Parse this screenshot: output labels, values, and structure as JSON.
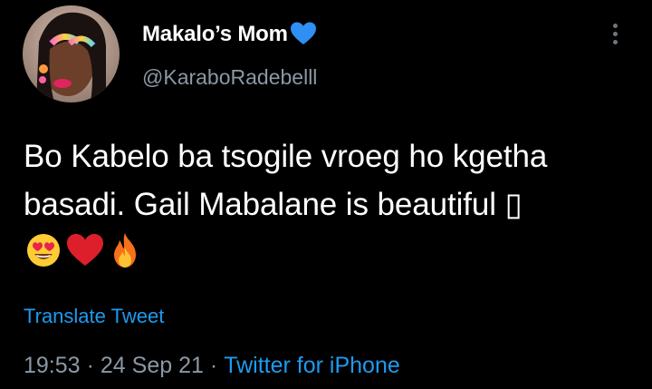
{
  "author": {
    "display_name": "Makalo’s Mom",
    "badge_icon": "blue-heart-icon",
    "handle": "@KaraboRadebelll"
  },
  "tweet": {
    "text": "Bo Kabelo ba tsogile vroeg ho kgetha basadi. Gail Mabalane is beautiful ",
    "missing_glyph": "▯",
    "emojis": [
      "heart-eyes-face-icon",
      "red-heart-icon",
      "fire-icon"
    ],
    "translate_label": "Translate Tweet"
  },
  "meta": {
    "time": "19:53",
    "date": "24 Sep 21",
    "separator": "·",
    "source": "Twitter for iPhone"
  },
  "colors": {
    "background": "#000000",
    "text": "#ffffff",
    "secondary": "#8b98a5",
    "link": "#1d9bf0"
  }
}
